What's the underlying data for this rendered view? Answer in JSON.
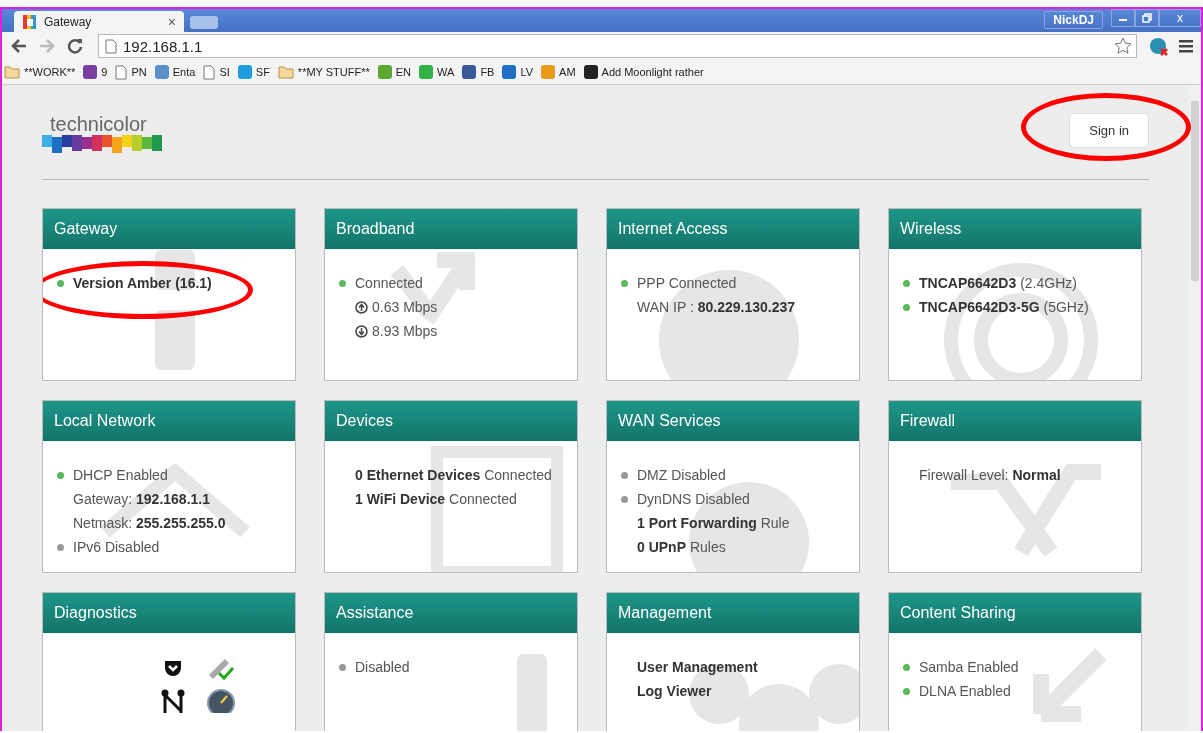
{
  "browser": {
    "tab": {
      "title": "Gateway",
      "close": "×"
    },
    "user": "NickDJ",
    "window_close": "x",
    "address": "192.168.1.1",
    "bookmarks": [
      {
        "kind": "folder",
        "label": "**WORK**"
      },
      {
        "kind": "site",
        "label": "9",
        "color": "#7b3fa0"
      },
      {
        "kind": "page",
        "label": "PN"
      },
      {
        "kind": "site",
        "label": "Enta",
        "color": "#5b8fc7"
      },
      {
        "kind": "page",
        "label": "SI"
      },
      {
        "kind": "site",
        "label": "SF",
        "color": "#1e9ee0"
      },
      {
        "kind": "folder",
        "label": "**MY STUFF**"
      },
      {
        "kind": "site",
        "label": "EN",
        "color": "#5aa832"
      },
      {
        "kind": "site",
        "label": "WA",
        "color": "#2fb34a"
      },
      {
        "kind": "site",
        "label": "FB",
        "color": "#3b5998"
      },
      {
        "kind": "site",
        "label": "LV",
        "color": "#1f6fc5"
      },
      {
        "kind": "site",
        "label": "AM",
        "color": "#e89a1a"
      },
      {
        "kind": "site",
        "label": "Add Moonlight rather",
        "color": "#222222"
      }
    ]
  },
  "page": {
    "logo": "technicolor",
    "sign_in": {
      "label": "Sign in",
      "highlighted": true
    },
    "cards": [
      {
        "title": "Gateway",
        "lines": [
          {
            "text": "Version Amber (16.1)",
            "bold": true,
            "color": "#5cb85c",
            "highlighted": true
          }
        ]
      },
      {
        "title": "Broadband",
        "lines": [
          {
            "text": "Connected",
            "color": "#5cb85c"
          },
          {
            "kind": "up",
            "text": "0.63 Mbps"
          },
          {
            "kind": "down",
            "text": "8.93 Mbps"
          }
        ]
      },
      {
        "title": "Internet Access",
        "lines": [
          {
            "text": "PPP Connected",
            "color": "#5cb85c"
          },
          {
            "text": "WAN IP : **80.229.130.237**"
          }
        ]
      },
      {
        "title": "Wireless",
        "lines": [
          {
            "text": "**TNCAP6642D3** (2.4GHz)",
            "color": "#5cb85c"
          },
          {
            "text": "**TNCAP6642D3-5G** (5GHz)",
            "color": "#5cb85c"
          }
        ]
      },
      {
        "title": "Local Network",
        "lines": [
          {
            "text": "DHCP Enabled",
            "color": "#5cb85c"
          },
          {
            "text": "Gateway: **192.168.1.1**"
          },
          {
            "text": "Netmask: **255.255.255.0**"
          },
          {
            "text": "IPv6 Disabled",
            "color": "#999999"
          }
        ]
      },
      {
        "title": "Devices",
        "lines": [
          {
            "text": "**0 Ethernet Devices** Connected"
          },
          {
            "text": "**1 WiFi Device** Connected"
          }
        ]
      },
      {
        "title": "WAN Services",
        "lines": [
          {
            "text": "DMZ Disabled",
            "color": "#999999"
          },
          {
            "text": "DynDNS Disabled",
            "color": "#999999"
          },
          {
            "text": "**1 Port Forwarding** Rule"
          },
          {
            "text": "**0 UPnP** Rules"
          }
        ]
      },
      {
        "title": "Firewall",
        "lines": [
          {
            "text": "Firewall Level: **Normal**"
          }
        ]
      },
      {
        "title": "Diagnostics",
        "lines": [
          {
            "kind": "tools"
          }
        ]
      },
      {
        "title": "Assistance",
        "lines": [
          {
            "text": "Disabled",
            "color": "#999999"
          }
        ]
      },
      {
        "title": "Management",
        "lines": [
          {
            "text": "User Management",
            "bold": true
          },
          {
            "text": "Log Viewer",
            "bold": true
          }
        ]
      },
      {
        "title": "Content Sharing",
        "lines": [
          {
            "text": "Samba Enabled",
            "color": "#5cb85c"
          },
          {
            "text": "DLNA Enabled",
            "color": "#5cb85c"
          }
        ]
      }
    ]
  }
}
